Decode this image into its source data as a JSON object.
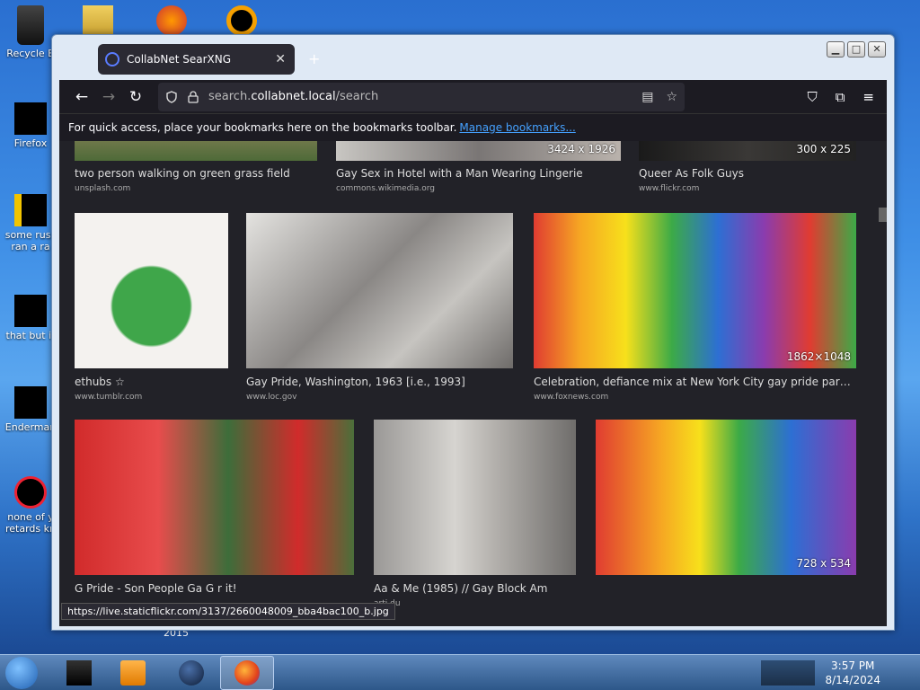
{
  "desktop": {
    "icons": [
      {
        "label": "Recycle B"
      },
      {
        "label": "Firefox"
      },
      {
        "label": "some russ",
        "label2": "ran a ra"
      },
      {
        "label": "that but it"
      },
      {
        "label": "Enderman"
      },
      {
        "label": "none of y",
        "label2": "retards kn"
      }
    ],
    "year_text": "2015"
  },
  "window": {
    "tab_title": "CollabNet SearXNG",
    "tab_close": "✕",
    "new_tab": "+",
    "url_domain": "collabnet.local",
    "url_prefix": "search.",
    "url_suffix": "/search",
    "bookmarks_text": "For quick access, place your bookmarks here on the bookmarks toolbar.",
    "bookmarks_link": "Manage bookmarks...",
    "status_url": "https://live.staticflickr.com/3137/2660048009_bba4bac100_b.jpg"
  },
  "results": [
    {
      "title": "two person walking on green grass field",
      "source": "unsplash.com",
      "dims": ""
    },
    {
      "title": "Gay Sex in Hotel with a Man Wearing Lingerie",
      "source": "commons.wikimedia.org",
      "dims": "3424 x 1926"
    },
    {
      "title": "Queer As Folk Guys",
      "source": "www.flickr.com",
      "dims": "300 x 225"
    },
    {
      "title": "ethubs ☆",
      "source": "www.tumblr.com",
      "dims": ""
    },
    {
      "title": "Gay Pride, Washington, 1963 [i.e., 1993]",
      "source": "www.loc.gov",
      "dims": ""
    },
    {
      "title": "Celebration, defiance mix at New York City gay pride parade…",
      "source": "www.foxnews.com",
      "dims": "1862×1048"
    },
    {
      "title": "G    Pride - Son    People     Ga    G        r it!",
      "source": "",
      "dims": ""
    },
    {
      "title": "Aa    & Me (1985) // Gay Block Am",
      "source": "arti       du",
      "dims": ""
    },
    {
      "title": "",
      "source": "",
      "dims": "728 x 534"
    }
  ],
  "taskbar": {
    "time": "3:57 PM",
    "date": "8/14/2024"
  }
}
